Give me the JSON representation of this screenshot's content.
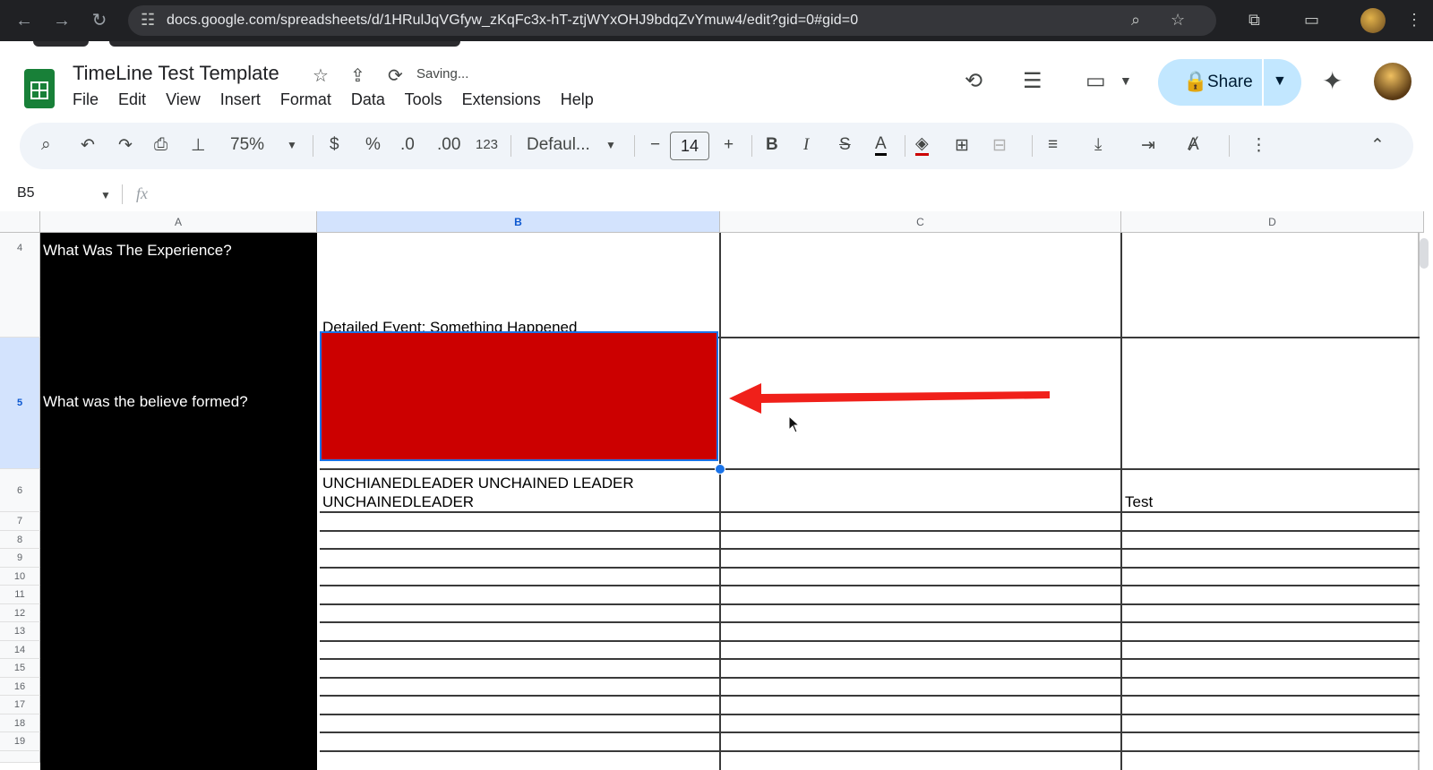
{
  "browser": {
    "url": "docs.google.com/spreadsheets/d/1HRulJqVGfyw_zKqFc3x-hT-ztjWYxOHJ9bdqZvYmuw4/edit?gid=0#gid=0",
    "icons": {
      "back": "←",
      "forward": "→",
      "reload": "↻",
      "tune": "☷",
      "zoom": "⌕",
      "star": "☆",
      "extensions": "⧉",
      "cast": "▭",
      "menu": "⋮"
    }
  },
  "doc": {
    "title": "TimeLine Test Template",
    "status": "Saving...",
    "menu": [
      "File",
      "Edit",
      "View",
      "Insert",
      "Format",
      "Data",
      "Tools",
      "Extensions",
      "Help"
    ],
    "share_label": "Share"
  },
  "toolbar": {
    "zoom": "75%",
    "currency": "$",
    "percent": "%",
    "dec_decrease": ".0",
    "dec_increase": ".00",
    "number_format": "123",
    "font": "Defaul...",
    "font_size": "14",
    "bold": "B",
    "italic": "I",
    "strike": "S",
    "text_color": "A"
  },
  "formula_bar": {
    "name_box": "B5",
    "fx": "fx"
  },
  "columns": [
    "A",
    "B",
    "C",
    "D"
  ],
  "rows": [
    "4",
    "5",
    "6",
    "7",
    "8",
    "9",
    "10",
    "11",
    "12",
    "13",
    "14",
    "15",
    "16",
    "17",
    "18",
    "19"
  ],
  "cells": {
    "A4": "What Was The Experience?",
    "B4": "Detailed Event: Something Happened",
    "A5": "What was the believe formed?",
    "B6_line1": "UNCHIANEDLEADER   UNCHAINED LEADER",
    "B6_line2": "UNCHAINEDLEADER",
    "D6": "Test"
  },
  "colors": {
    "selected_fill": "#cc0000",
    "black_column": "#000000",
    "arrow": "#f0201a",
    "share_bg": "#c2e7ff",
    "selection_border": "#1a73e8"
  }
}
